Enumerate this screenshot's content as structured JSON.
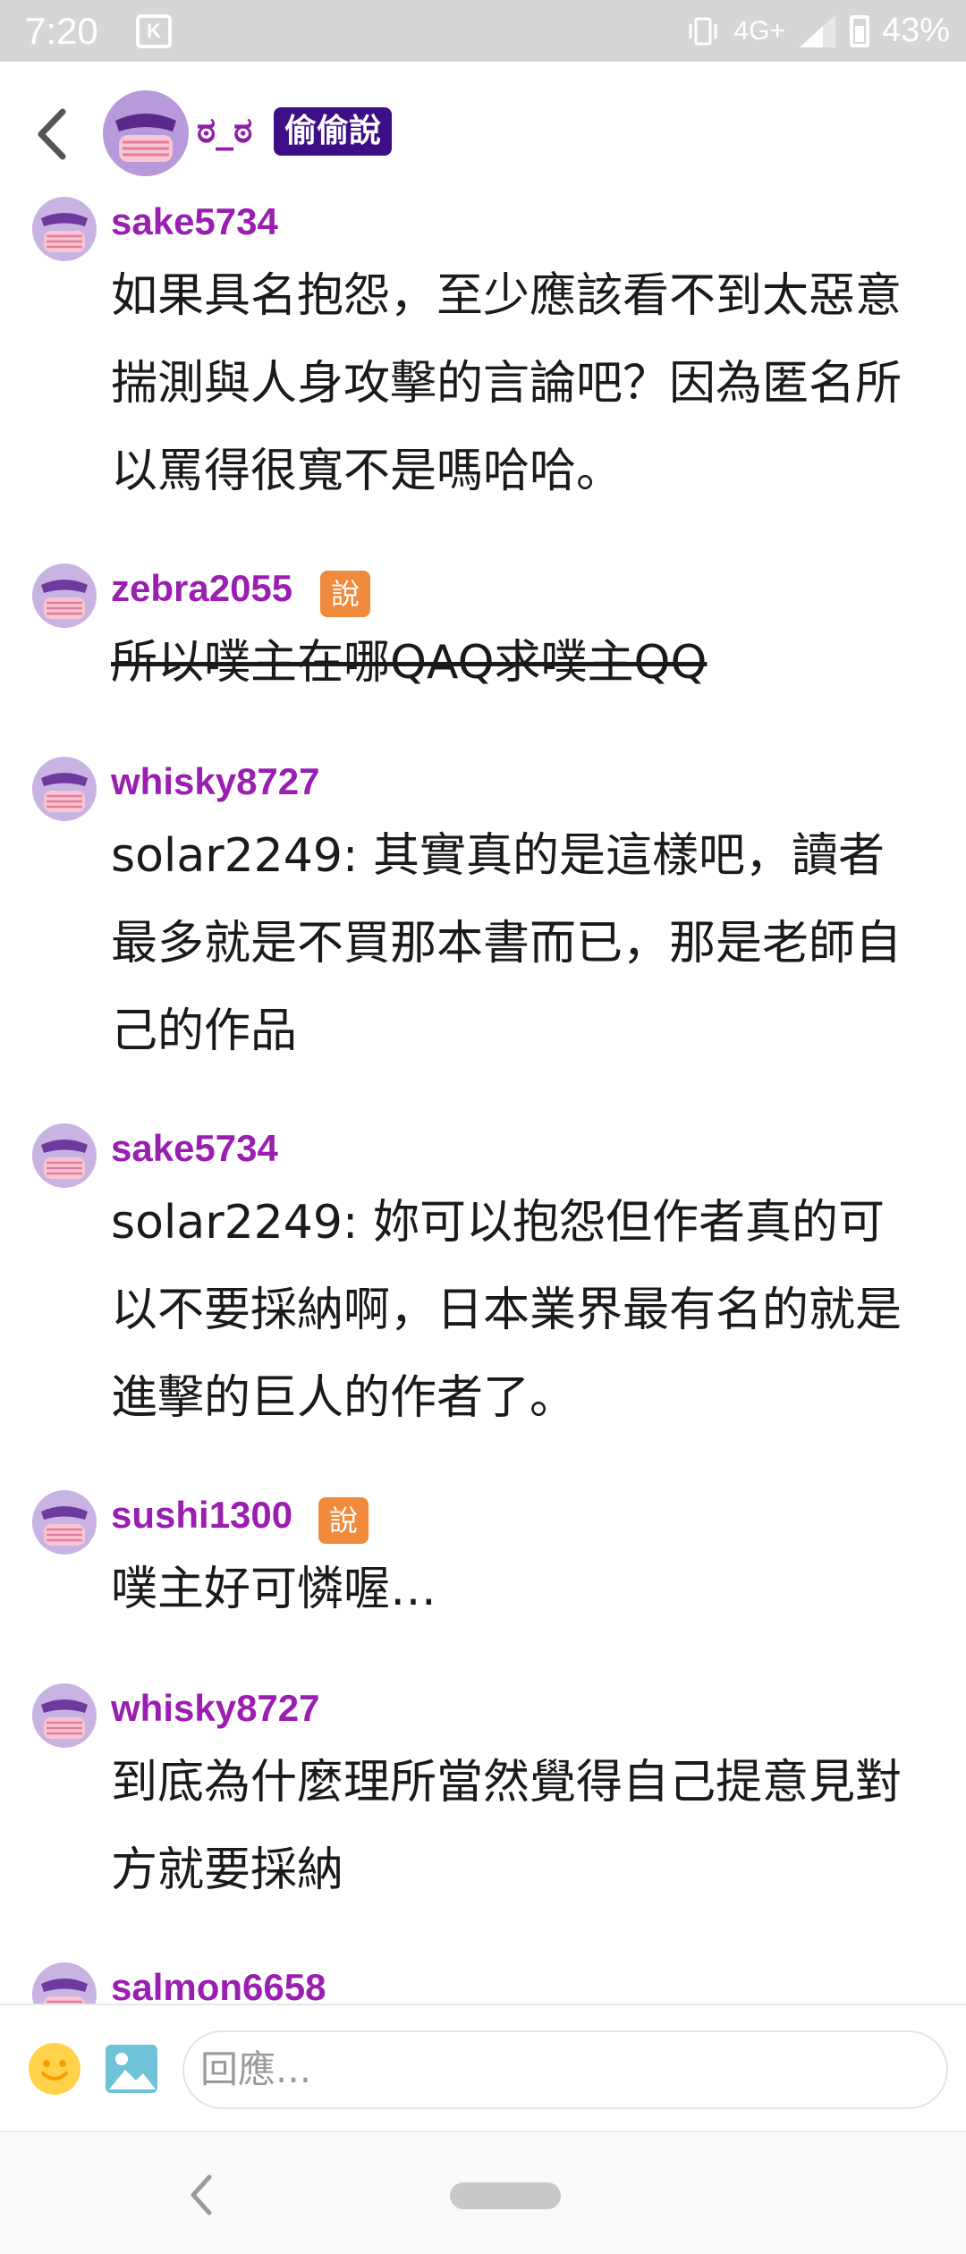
{
  "status_bar": {
    "time": "7:20",
    "app_icon_letter": "K",
    "network": "4G+",
    "battery": "43%"
  },
  "header": {
    "name": "ಠ_ಠ",
    "badge": "偷偷說"
  },
  "comments": [
    {
      "user": "sake5734",
      "badge": "",
      "text": "如果具名抱怨，至少應該看不到太惡意揣測與人身攻擊的言論吧？因為匿名所以罵得很寬不是嗎哈哈。",
      "struck": false
    },
    {
      "user": "zebra2055",
      "badge": "說",
      "text": "所以噗主在哪QAQ求噗主QQ",
      "struck": true
    },
    {
      "user": "whisky8727",
      "badge": "",
      "text": "solar2249: 其實真的是這樣吧，讀者最多就是不買那本書而已，那是老師自己的作品",
      "struck": false
    },
    {
      "user": "sake5734",
      "badge": "",
      "text": "solar2249: 妳可以抱怨但作者真的可以不要採納啊，日本業界最有名的就是進擊的巨人的作者了。",
      "struck": false
    },
    {
      "user": "sushi1300",
      "badge": "說",
      "text": "噗主好可憐喔…",
      "struck": false
    },
    {
      "user": "whisky8727",
      "badge": "",
      "text": "到底為什麼理所當然覺得自己提意見對方就要採納",
      "struck": false
    },
    {
      "user": "salmon6658",
      "badge": "",
      "text": "",
      "struck": false
    }
  ],
  "reply": {
    "placeholder": "回應..."
  },
  "colors": {
    "username": "#9a1fb0",
    "header_badge_bg": "#3d0f86",
    "user_badge_bg": "#f08a3c",
    "status_bar_bg": "#d6d6d6"
  }
}
